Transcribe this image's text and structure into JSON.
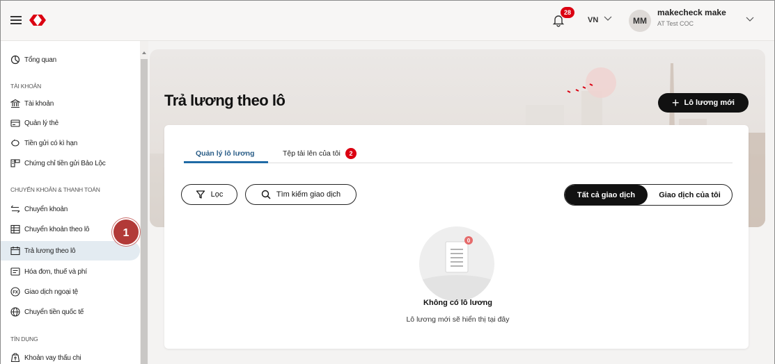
{
  "header": {
    "notification_count": "28",
    "language": "VN",
    "avatar_initials": "MM",
    "user_name": "makecheck make",
    "company": "AT Test COC"
  },
  "sidebar": {
    "overview": "Tổng quan",
    "sections": {
      "accounts": "TÀI KHOẢN",
      "transfers": "CHUYỂN KHOẢN & THANH TOÁN",
      "credit": "TÍN DỤNG"
    },
    "items": [
      {
        "label": "Tài khoản",
        "icon": "bank-icon"
      },
      {
        "label": "Quản lý thẻ",
        "icon": "card-icon"
      },
      {
        "label": "Tiền gửi có kì hạn",
        "icon": "piggy-bank-icon"
      },
      {
        "label": "Chứng chỉ tiền gửi Bảo Lộc",
        "icon": "certificate-icon"
      },
      {
        "label": "Chuyển khoản",
        "icon": "transfer-icon"
      },
      {
        "label": "Chuyển khoản theo lô",
        "icon": "table-icon"
      },
      {
        "label": "Trả lương theo lô",
        "icon": "calendar-icon"
      },
      {
        "label": "Hóa đơn, thuế và phí",
        "icon": "bill-icon"
      },
      {
        "label": "Giao dịch ngoại tệ",
        "icon": "fx-icon"
      },
      {
        "label": "Chuyển tiền quốc tế",
        "icon": "globe-icon"
      },
      {
        "label": "Khoản vay thấu chi",
        "icon": "loan-icon"
      }
    ],
    "active_item": "Trả lương theo lô"
  },
  "step_marker": "1",
  "main": {
    "title": "Trả lương theo lô",
    "new_batch_button": "Lô lương mới",
    "tabs": [
      {
        "label": "Quản lý lô lương",
        "active": true
      },
      {
        "label": "Tệp tải lên của tôi",
        "badge": "2"
      }
    ],
    "filter_button": "Lọc",
    "search_button": "Tìm kiếm giao dịch",
    "segments": [
      "Tất cả giao dịch",
      "Giao dịch của tôi"
    ],
    "empty_badge": "0",
    "empty_title": "Không có lô lương",
    "empty_subtitle": "Lô lương mới sẽ hiển thị tại đây"
  },
  "colors": {
    "brand_red": "#db0011",
    "active_tab": "#1f6aa5",
    "active_nav_bg": "#e3ebf1",
    "step_marker": "#b23a38"
  }
}
